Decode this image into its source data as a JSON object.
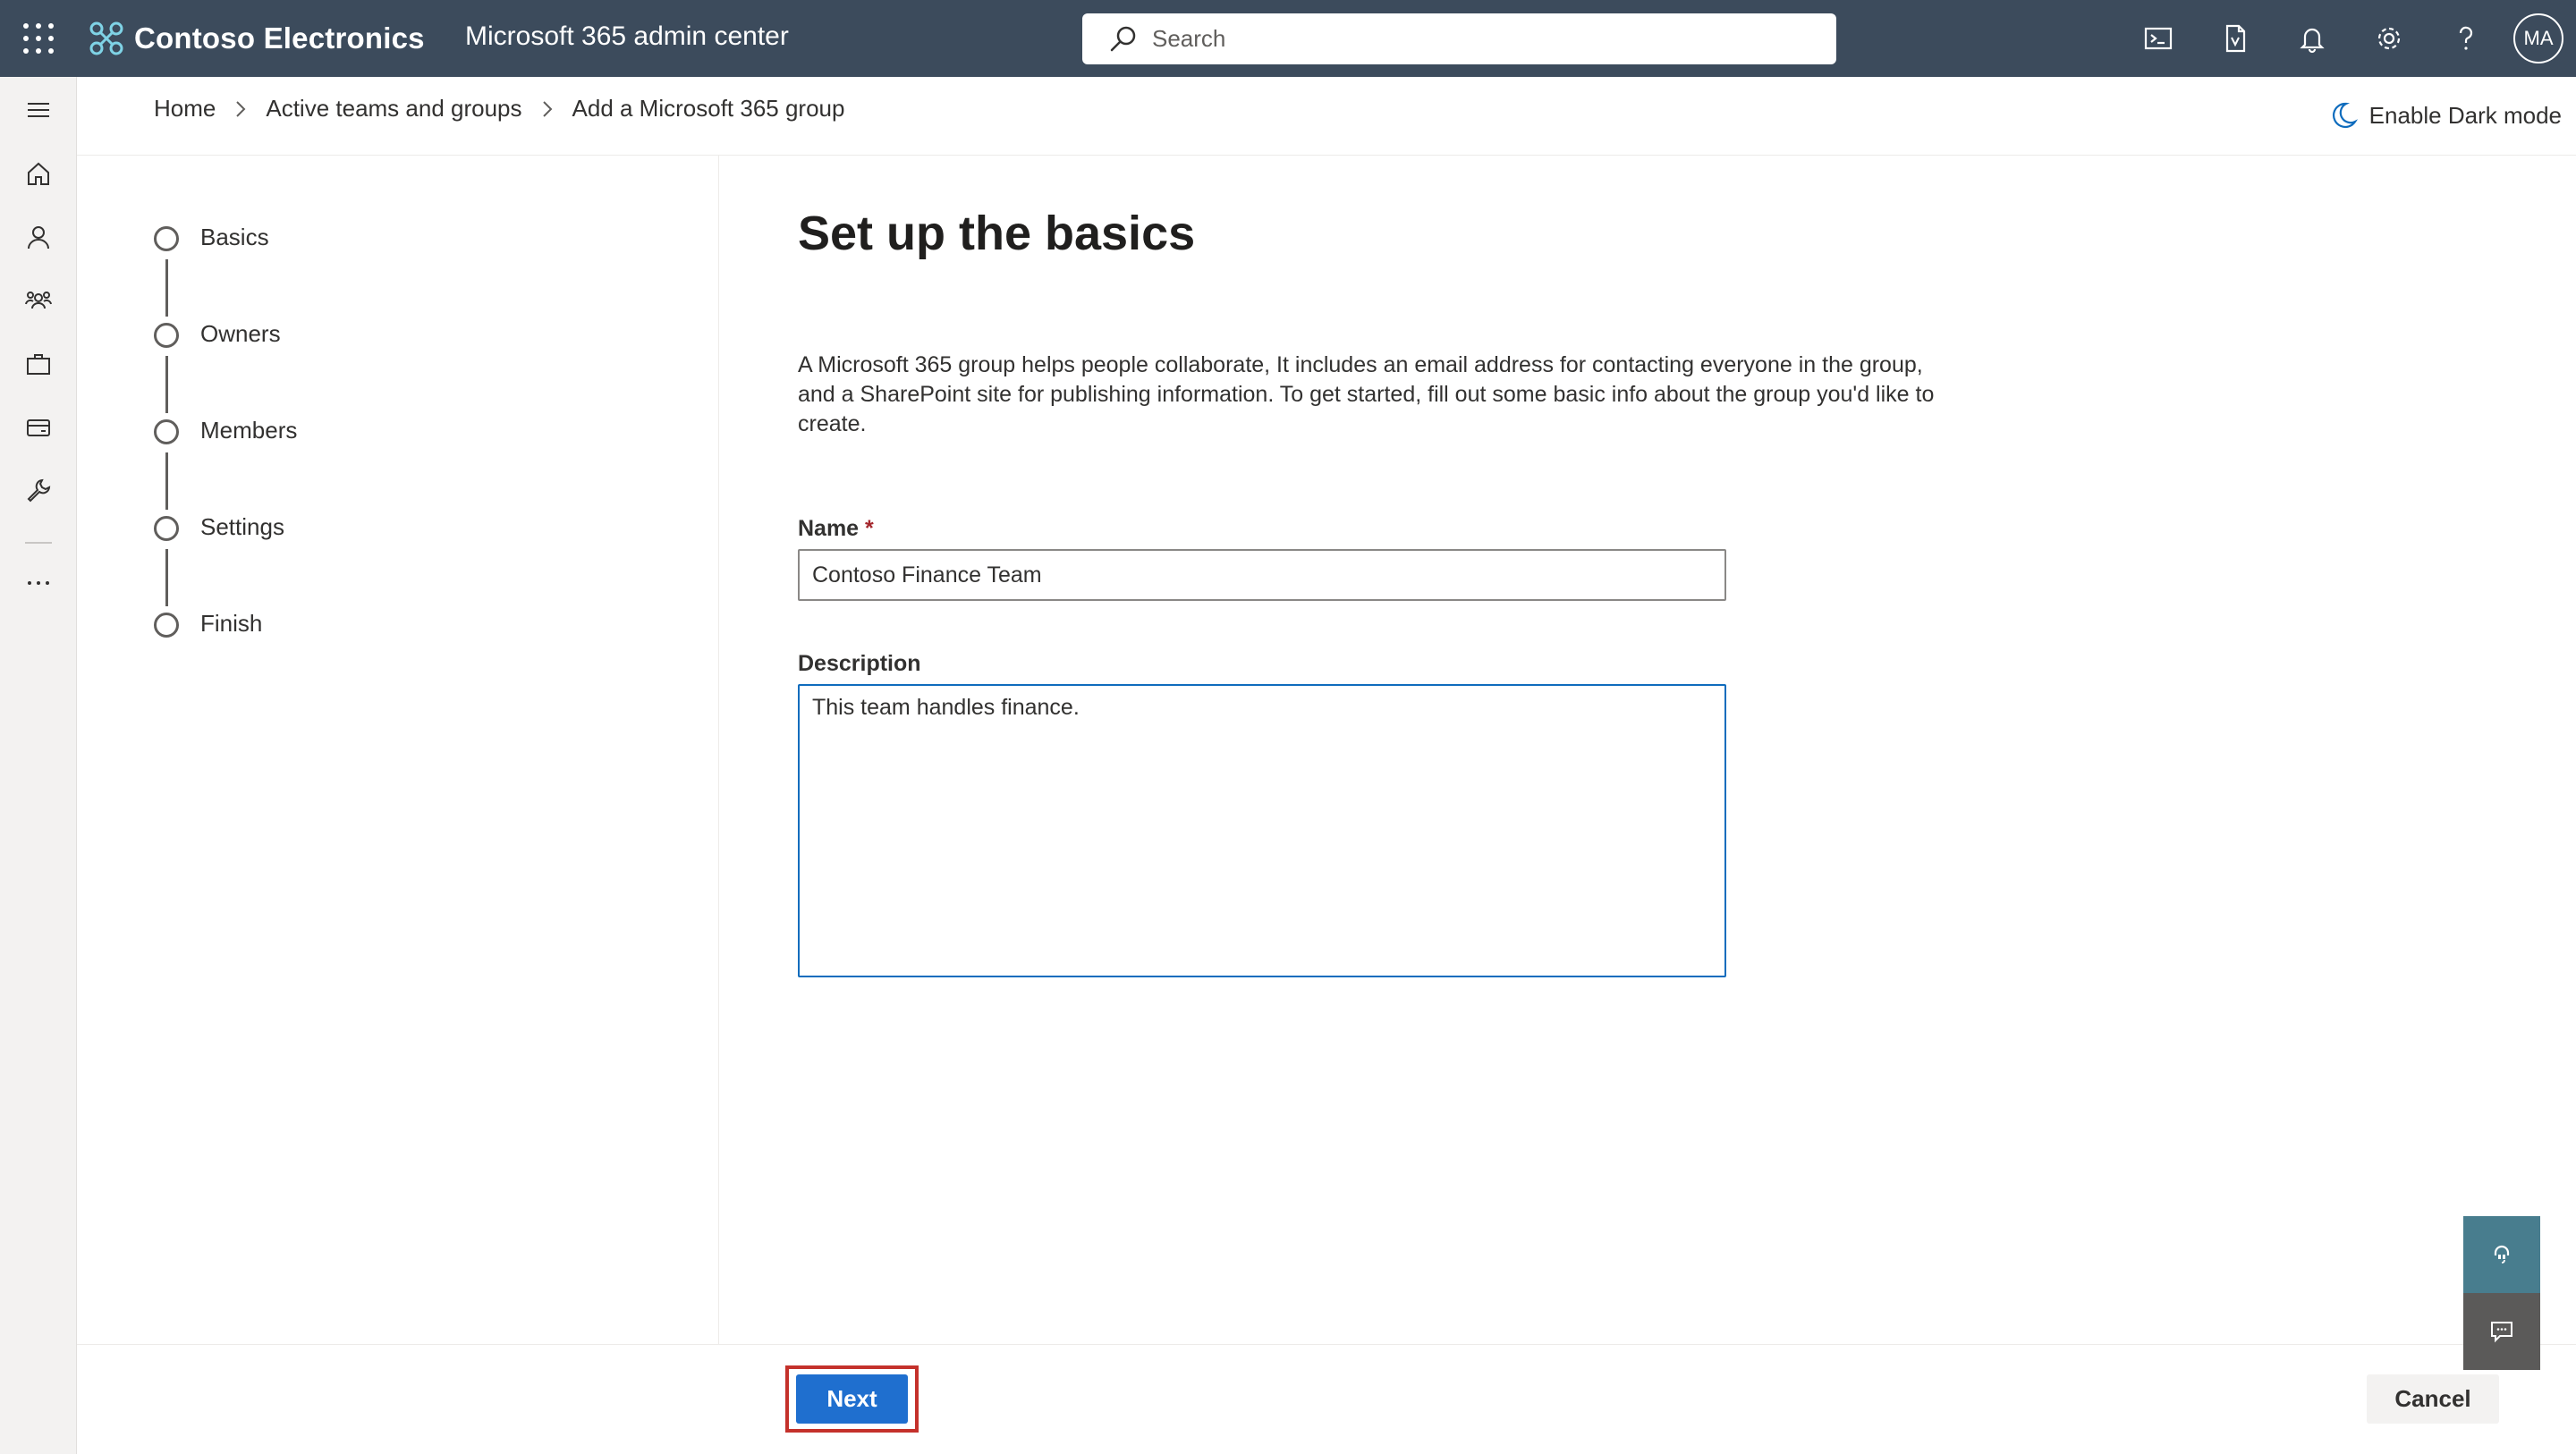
{
  "header": {
    "org_name": "Contoso Electronics",
    "app_title": "Microsoft 365 admin center",
    "search_placeholder": "Search",
    "avatar_initials": "MA"
  },
  "breadcrumb": {
    "items": [
      "Home",
      "Active teams and groups",
      "Add a Microsoft 365 group"
    ]
  },
  "dark_mode_label": "Enable Dark mode",
  "steps": [
    "Basics",
    "Owners",
    "Members",
    "Settings",
    "Finish"
  ],
  "form": {
    "heading": "Set up the basics",
    "intro": "A Microsoft 365 group helps people collaborate, It includes an email address for contacting everyone in the group, and a SharePoint site for publishing information. To get started, fill out some basic info about the group you'd like to create.",
    "name_label": "Name",
    "required_marker": "*",
    "name_value": "Contoso Finance Team",
    "description_label": "Description",
    "description_value": "This team handles finance."
  },
  "footer": {
    "next_label": "Next",
    "cancel_label": "Cancel"
  },
  "colors": {
    "header_bg": "#3c4b5c",
    "primary_button": "#1f6fcf",
    "highlight_border": "#c4312b",
    "support_fab": "#487d8e",
    "feedback_fab": "#5b5a59"
  },
  "icons": {
    "rail": [
      "menu-icon",
      "home-icon",
      "user-icon",
      "groups-icon",
      "briefcase-icon",
      "billing-icon",
      "wrench-icon",
      "more-icon"
    ],
    "top": [
      "terminal-icon",
      "document-icon",
      "bell-icon",
      "gear-icon",
      "help-icon"
    ]
  }
}
